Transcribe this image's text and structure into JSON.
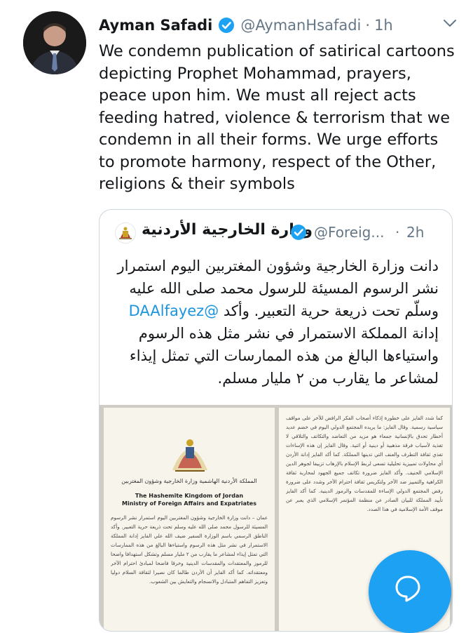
{
  "tweet": {
    "author_name": "Ayman Safadi",
    "handle": "@AymanHsafadi",
    "separator": "·",
    "time": "1h",
    "text": "We condemn publication of satirical cartoons depicting Prophet Mohammad, prayers, peace upon him. We must all reject acts feeding hatred, violence & terrorism that we condemn in all their forms. We urge efforts to promote harmony, respect of the Other, religions & their symbols",
    "avatar_icon": "person-avatar",
    "verified_icon": "verified-badge-icon",
    "menu_icon": "chevron-down-icon"
  },
  "quote": {
    "name": "وزارة الخارجية الأردنية",
    "handle": "@Foreig...",
    "separator": "·",
    "time": "2h",
    "text_part1": "دانت وزارة الخارجية وشؤون المغتربين اليوم استمرار نشر الرسوم المسيئة للرسول محمد صلى الله عليه وسلّم تحت ذريعة حرية التعبير. وأكد ",
    "mention": "@DAAlfayez",
    "text_part2": " إدانة المملكة الاستمرار في نشر مثل هذه الرسوم واستياءها البالغ من هذه الممارسات التي تمثل إيذاء لمشاعر ما يقارب من ٢ مليار مسلم.",
    "logo_icon": "jordan-emblem-icon"
  },
  "document": {
    "ministry_ar": "المملكة الأردنية الهاشمية وزارة الخارجية وشؤون المغتربين",
    "ministry_en_line1": "The Hashemite Kingdom of Jordan",
    "ministry_en_line2": "Ministry of Foreign Affairs and Expatriates",
    "left_body": "عمان – دانت وزارة الخارجية وشؤون المغتربين اليوم استمرار نشر الرسوم المسيئة للرسول محمد صلى الله عليه وسلم تحت ذريعة حرية التعبير. وأكد الناطق الرسمي باسم الوزارة السفير ضيف الله علي الفايز إدانة المملكة الاستمرار في نشر مثل هذه الرسوم واستياءها البالغ من هذه الممارسات التي تمثل إيذاء لمشاعر ما يقارب من ٢ مليار مسلم وتشكل استهدافا واضحا للرموز والمعتقدات والمقدسات الدينية وخرقا فاضحا لمبادئ احترام الآخر ومعتقداته. كما أكد الفايز أن الأردن طالما كان نصيرا لثقافة السلام دوليا وتعزيز التفاهم المتبادل والانسجام والتعايش بين الشعوب.",
    "right_body": "كما شدد الفايز على خطورة إذكاء أصحاب الفكر الرافض للآخر على مواقف سياسية رسمية. وقال الفايز: ما يريده المجتمع الدولي اليوم في خضم عديد أخطار تحدق بالإنسانية جمعاء هو مزيد من التعاضد والتكاتف والتلاقي لا تغذية لأسباب فرقة مذهبية أو دينية أو اثنية. وقال الفايز إن هذه الإساءات تغذي ثقافة التطرف والعنف التي تدينها المملكة. كما أكد الفايز إدانة الأردن أي محاولات تمييزية تحليلية تسعى لربط الإسلام بالإرهاب تزييفا لجوهر الدين الإسلامي الحنيف. وأكد الفايز ضرورة تكاتف جميع الجهود لمحاربة ثقافة الكراهية والتمييز ضد الآخر ولتكريس ثقافة احترام الآخر وشدد على ضرورة رفض المجتمع الدولي الإساءة للمقدسات والرموز الدينية. كما أكد الفايز تأييد المملكة للبيان الصادر عن منظمة المؤتمر الإسلامي الذي يعبر عن موقف الأمة الإسلامية في هذا الصدد."
  },
  "fab": {
    "icon": "compose-reply-icon"
  }
}
